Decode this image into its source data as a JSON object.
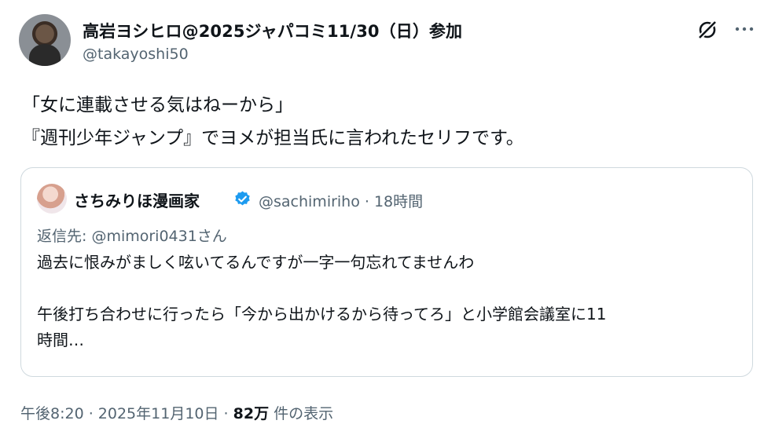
{
  "author": {
    "display_name": "高岩ヨシヒロ@2025ジャパコミ11/30（日）参加",
    "handle": "@takayoshi50"
  },
  "icons": {
    "grok": "grok-icon",
    "more": "more-icon",
    "verified": "verified-icon"
  },
  "tweet": {
    "lines": [
      "「女に連載させる気はねーから」",
      "『週刊少年ジャンプ』でヨメが担当氏に言われたセリフです。"
    ]
  },
  "quote": {
    "display_name": "さちみりほ漫画家",
    "handle_time": "@sachimiriho · 18時間",
    "reply_to": "返信先: @mimori0431さん",
    "body_lines": [
      "過去に恨みがましく呟いてるんですが一字一句忘れてませんわ",
      "",
      "午後打ち合わせに行ったら「今から出かけるから待ってろ」と小学館会議室に11",
      "時間…"
    ],
    "verified_color": "#1d9bf0"
  },
  "meta": {
    "timestamp": "午後8:20 · 2025年11月10日 · ",
    "views_count": "82万",
    "views_label": " 件の表示"
  }
}
